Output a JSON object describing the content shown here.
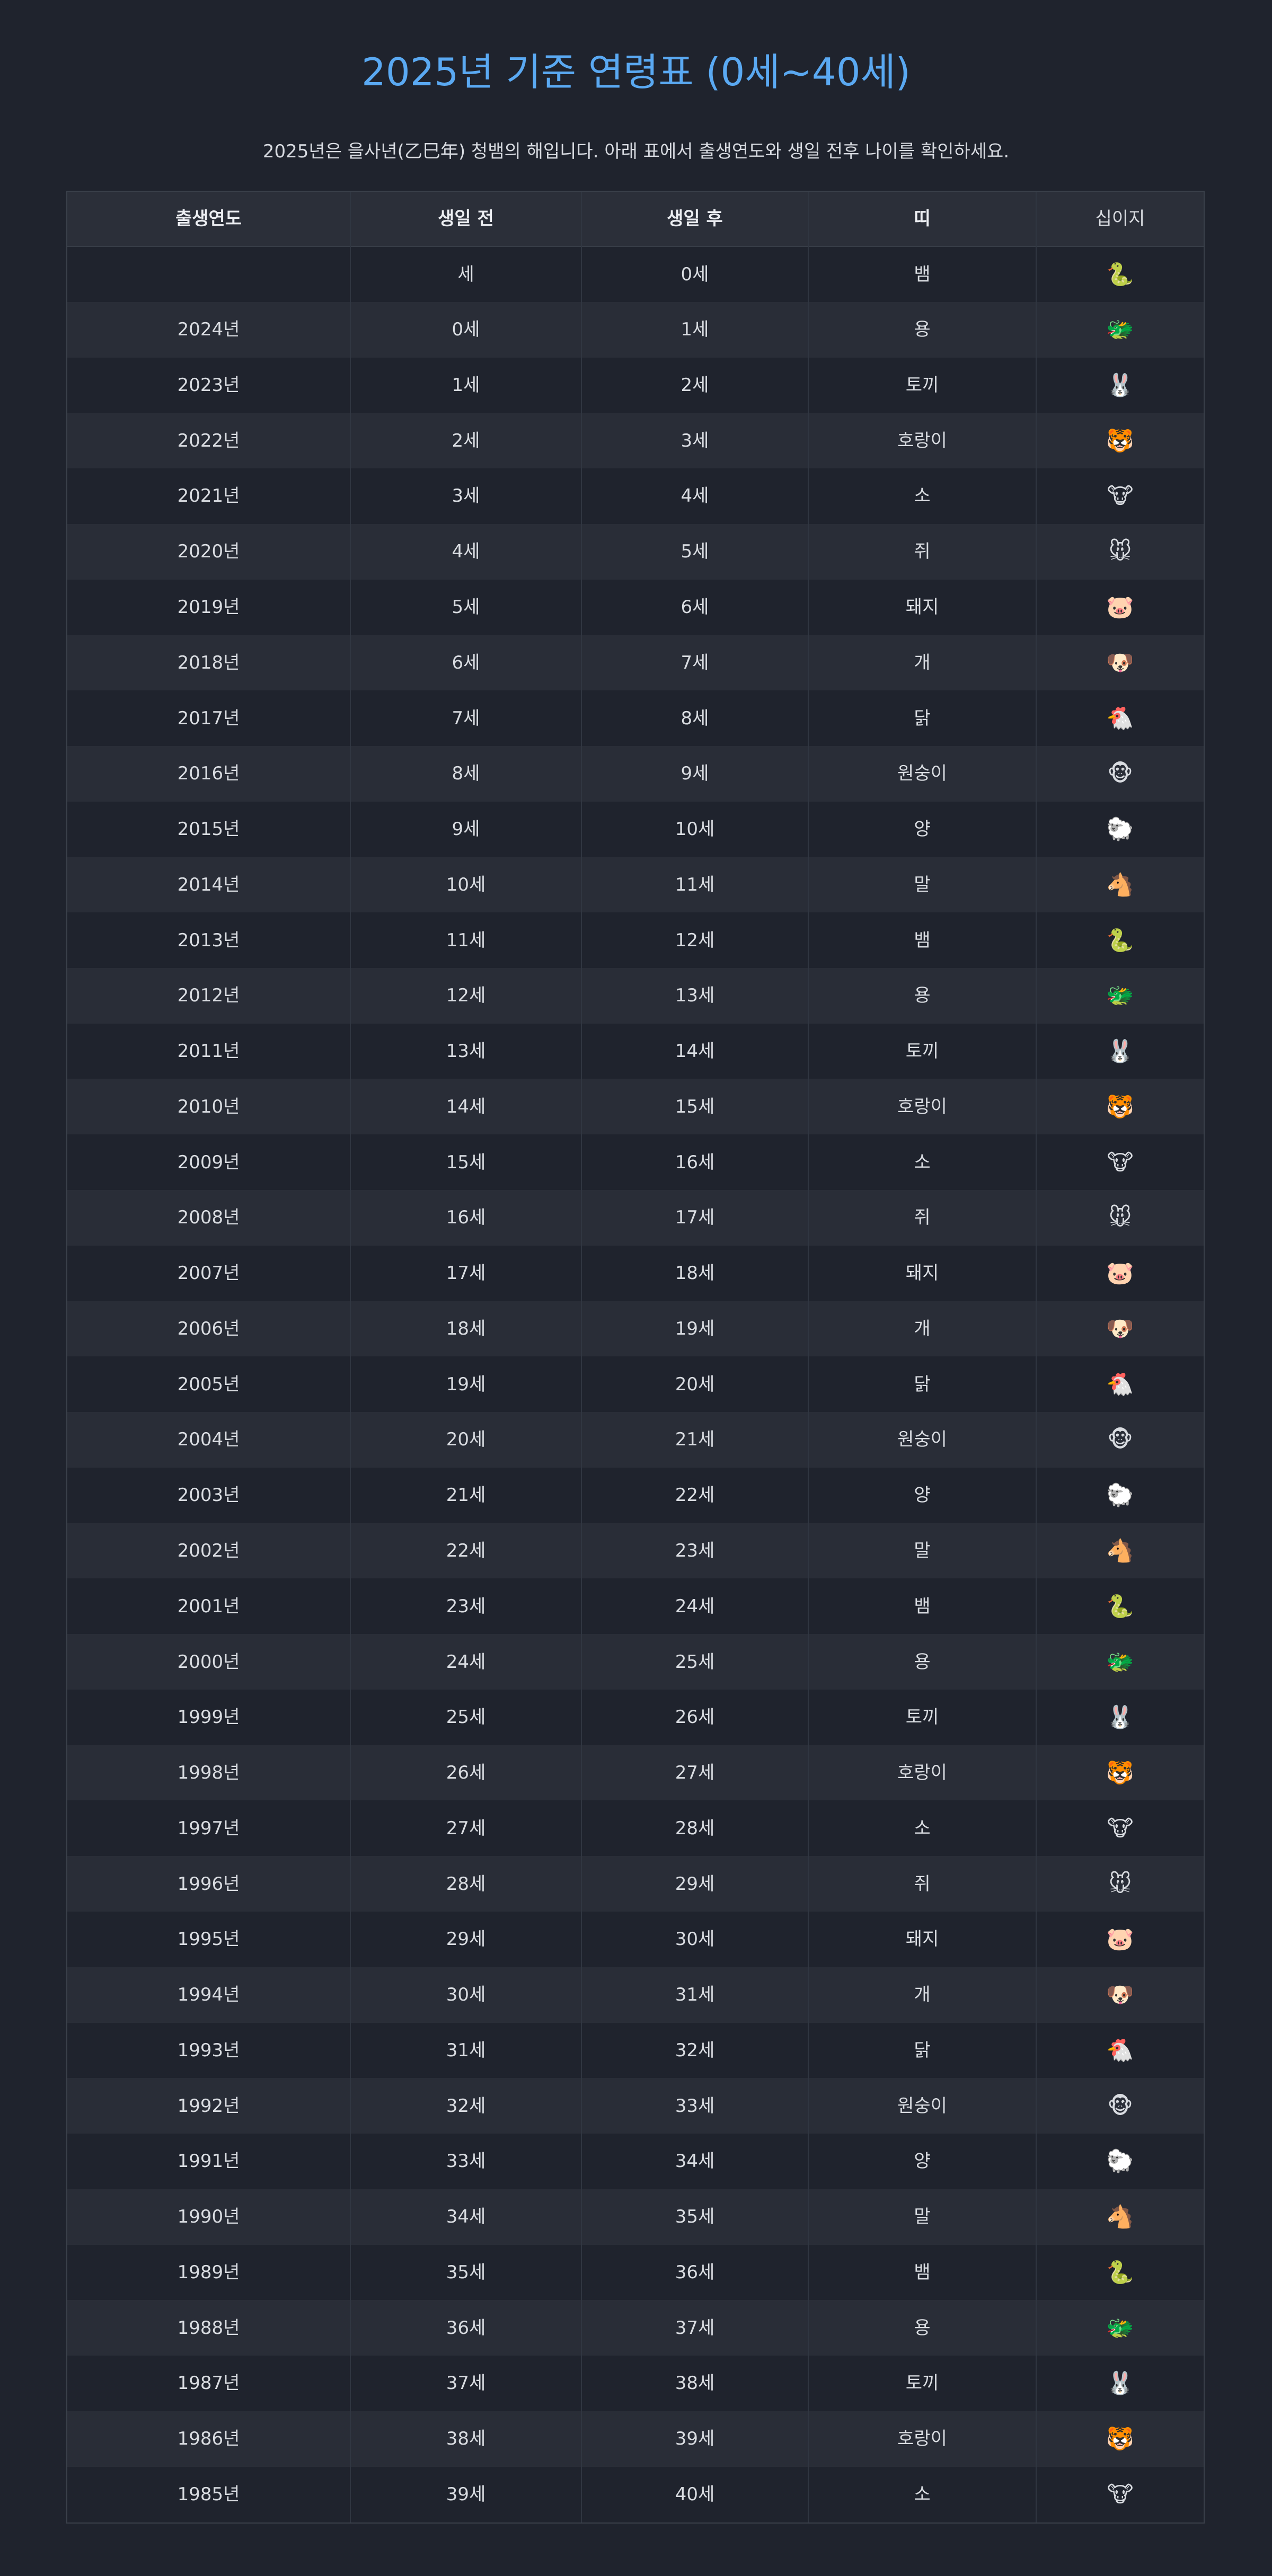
{
  "page": {
    "title": "2025년 기준 연령표 (0세~40세)",
    "subtitle": "2025년은 을사년(乙巳年) 청뱀의 해입니다. 아래 표에서 출생연도와 생일 전후 나이를 확인하세요."
  },
  "table": {
    "headers": [
      "출생연도",
      "생일 전",
      "생일 후",
      "띠",
      "십이지"
    ],
    "rows": [
      {
        "year": "",
        "before": "세",
        "after": "0세",
        "zodiac": "뱀",
        "icon": "🐍",
        "icon_name": "snake-icon"
      },
      {
        "year": "2024년",
        "before": "0세",
        "after": "1세",
        "zodiac": "용",
        "icon": "🐲",
        "icon_name": "dragon-icon"
      },
      {
        "year": "2023년",
        "before": "1세",
        "after": "2세",
        "zodiac": "토끼",
        "icon": "🐰",
        "icon_name": "rabbit-icon"
      },
      {
        "year": "2022년",
        "before": "2세",
        "after": "3세",
        "zodiac": "호랑이",
        "icon": "🐯",
        "icon_name": "tiger-icon"
      },
      {
        "year": "2021년",
        "before": "3세",
        "after": "4세",
        "zodiac": "소",
        "icon": "🐮",
        "icon_name": "ox-icon"
      },
      {
        "year": "2020년",
        "before": "4세",
        "after": "5세",
        "zodiac": "쥐",
        "icon": "🐭",
        "icon_name": "rat-icon"
      },
      {
        "year": "2019년",
        "before": "5세",
        "after": "6세",
        "zodiac": "돼지",
        "icon": "🐷",
        "icon_name": "pig-icon"
      },
      {
        "year": "2018년",
        "before": "6세",
        "after": "7세",
        "zodiac": "개",
        "icon": "🐶",
        "icon_name": "dog-icon"
      },
      {
        "year": "2017년",
        "before": "7세",
        "after": "8세",
        "zodiac": "닭",
        "icon": "🐔",
        "icon_name": "rooster-icon"
      },
      {
        "year": "2016년",
        "before": "8세",
        "after": "9세",
        "zodiac": "원숭이",
        "icon": "🐵",
        "icon_name": "monkey-icon"
      },
      {
        "year": "2015년",
        "before": "9세",
        "after": "10세",
        "zodiac": "양",
        "icon": "🐑",
        "icon_name": "sheep-icon"
      },
      {
        "year": "2014년",
        "before": "10세",
        "after": "11세",
        "zodiac": "말",
        "icon": "🐴",
        "icon_name": "horse-icon"
      },
      {
        "year": "2013년",
        "before": "11세",
        "after": "12세",
        "zodiac": "뱀",
        "icon": "🐍",
        "icon_name": "snake-icon"
      },
      {
        "year": "2012년",
        "before": "12세",
        "after": "13세",
        "zodiac": "용",
        "icon": "🐲",
        "icon_name": "dragon-icon"
      },
      {
        "year": "2011년",
        "before": "13세",
        "after": "14세",
        "zodiac": "토끼",
        "icon": "🐰",
        "icon_name": "rabbit-icon"
      },
      {
        "year": "2010년",
        "before": "14세",
        "after": "15세",
        "zodiac": "호랑이",
        "icon": "🐯",
        "icon_name": "tiger-icon"
      },
      {
        "year": "2009년",
        "before": "15세",
        "after": "16세",
        "zodiac": "소",
        "icon": "🐮",
        "icon_name": "ox-icon"
      },
      {
        "year": "2008년",
        "before": "16세",
        "after": "17세",
        "zodiac": "쥐",
        "icon": "🐭",
        "icon_name": "rat-icon"
      },
      {
        "year": "2007년",
        "before": "17세",
        "after": "18세",
        "zodiac": "돼지",
        "icon": "🐷",
        "icon_name": "pig-icon"
      },
      {
        "year": "2006년",
        "before": "18세",
        "after": "19세",
        "zodiac": "개",
        "icon": "🐶",
        "icon_name": "dog-icon"
      },
      {
        "year": "2005년",
        "before": "19세",
        "after": "20세",
        "zodiac": "닭",
        "icon": "🐔",
        "icon_name": "rooster-icon"
      },
      {
        "year": "2004년",
        "before": "20세",
        "after": "21세",
        "zodiac": "원숭이",
        "icon": "🐵",
        "icon_name": "monkey-icon"
      },
      {
        "year": "2003년",
        "before": "21세",
        "after": "22세",
        "zodiac": "양",
        "icon": "🐑",
        "icon_name": "sheep-icon"
      },
      {
        "year": "2002년",
        "before": "22세",
        "after": "23세",
        "zodiac": "말",
        "icon": "🐴",
        "icon_name": "horse-icon"
      },
      {
        "year": "2001년",
        "before": "23세",
        "after": "24세",
        "zodiac": "뱀",
        "icon": "🐍",
        "icon_name": "snake-icon"
      },
      {
        "year": "2000년",
        "before": "24세",
        "after": "25세",
        "zodiac": "용",
        "icon": "🐲",
        "icon_name": "dragon-icon"
      },
      {
        "year": "1999년",
        "before": "25세",
        "after": "26세",
        "zodiac": "토끼",
        "icon": "🐰",
        "icon_name": "rabbit-icon"
      },
      {
        "year": "1998년",
        "before": "26세",
        "after": "27세",
        "zodiac": "호랑이",
        "icon": "🐯",
        "icon_name": "tiger-icon"
      },
      {
        "year": "1997년",
        "before": "27세",
        "after": "28세",
        "zodiac": "소",
        "icon": "🐮",
        "icon_name": "ox-icon"
      },
      {
        "year": "1996년",
        "before": "28세",
        "after": "29세",
        "zodiac": "쥐",
        "icon": "🐭",
        "icon_name": "rat-icon"
      },
      {
        "year": "1995년",
        "before": "29세",
        "after": "30세",
        "zodiac": "돼지",
        "icon": "🐷",
        "icon_name": "pig-icon"
      },
      {
        "year": "1994년",
        "before": "30세",
        "after": "31세",
        "zodiac": "개",
        "icon": "🐶",
        "icon_name": "dog-icon"
      },
      {
        "year": "1993년",
        "before": "31세",
        "after": "32세",
        "zodiac": "닭",
        "icon": "🐔",
        "icon_name": "rooster-icon"
      },
      {
        "year": "1992년",
        "before": "32세",
        "after": "33세",
        "zodiac": "원숭이",
        "icon": "🐵",
        "icon_name": "monkey-icon"
      },
      {
        "year": "1991년",
        "before": "33세",
        "after": "34세",
        "zodiac": "양",
        "icon": "🐑",
        "icon_name": "sheep-icon"
      },
      {
        "year": "1990년",
        "before": "34세",
        "after": "35세",
        "zodiac": "말",
        "icon": "🐴",
        "icon_name": "horse-icon"
      },
      {
        "year": "1989년",
        "before": "35세",
        "after": "36세",
        "zodiac": "뱀",
        "icon": "🐍",
        "icon_name": "snake-icon"
      },
      {
        "year": "1988년",
        "before": "36세",
        "after": "37세",
        "zodiac": "용",
        "icon": "🐲",
        "icon_name": "dragon-icon"
      },
      {
        "year": "1987년",
        "before": "37세",
        "after": "38세",
        "zodiac": "토끼",
        "icon": "🐰",
        "icon_name": "rabbit-icon"
      },
      {
        "year": "1986년",
        "before": "38세",
        "after": "39세",
        "zodiac": "호랑이",
        "icon": "🐯",
        "icon_name": "tiger-icon"
      },
      {
        "year": "1985년",
        "before": "39세",
        "after": "40세",
        "zodiac": "소",
        "icon": "🐮",
        "icon_name": "ox-icon"
      }
    ]
  }
}
